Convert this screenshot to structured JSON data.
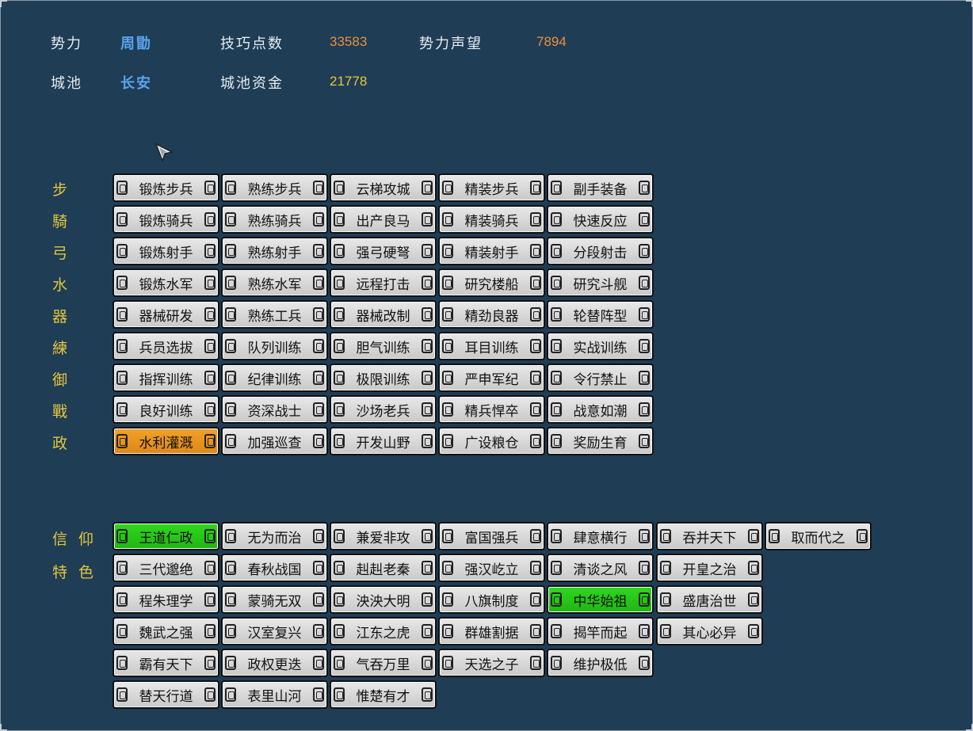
{
  "header": {
    "faction_label": "势力",
    "faction_value": "周勖",
    "skill_points_label": "技巧点数",
    "skill_points_value": "33583",
    "prestige_label": "势力声望",
    "prestige_value": "7894",
    "city_label": "城池",
    "city_value": "长安",
    "city_funds_label": "城池资金",
    "city_funds_value": "21778"
  },
  "colors": {
    "background": "#1f3d55",
    "accent_blue": "#5aa4ee",
    "accent_orange": "#e8913c",
    "accent_yellow": "#e8c93a",
    "selected_orange": "#f2a128",
    "selected_green": "#2fd81d"
  },
  "techniques": {
    "rows": [
      {
        "label": "步",
        "items": [
          "锻炼步兵",
          "熟练步兵",
          "云梯攻城",
          "精装步兵",
          "副手装备"
        ]
      },
      {
        "label": "騎",
        "items": [
          "锻炼骑兵",
          "熟练骑兵",
          "出产良马",
          "精装骑兵",
          "快速反应"
        ]
      },
      {
        "label": "弓",
        "items": [
          "锻炼射手",
          "熟练射手",
          "强弓硬弩",
          "精装射手",
          "分段射击"
        ]
      },
      {
        "label": "水",
        "items": [
          "锻炼水军",
          "熟练水军",
          "远程打击",
          "研究楼船",
          "研究斗舰"
        ]
      },
      {
        "label": "器",
        "items": [
          "器械研发",
          "熟练工兵",
          "器械改制",
          "精劲良器",
          "轮替阵型"
        ]
      },
      {
        "label": "練",
        "items": [
          "兵员选拔",
          "队列训练",
          "胆气训练",
          "耳目训练",
          "实战训练"
        ]
      },
      {
        "label": "御",
        "items": [
          "指挥训练",
          "纪律训练",
          "极限训练",
          "严申军纪",
          "令行禁止"
        ]
      },
      {
        "label": "戰",
        "items": [
          "良好训练",
          "资深战士",
          "沙场老兵",
          "精兵悍卒",
          "战意如潮"
        ]
      },
      {
        "label": "政",
        "items": [
          "水利灌溉",
          "加强巡查",
          "开发山野",
          "广设粮仓",
          "奖励生育"
        ]
      }
    ]
  },
  "beliefs": {
    "label_1": "信仰",
    "label_2": "特色",
    "rows": [
      [
        "王道仁政",
        "无为而治",
        "兼爱非攻",
        "富国强兵",
        "肆意横行",
        "吞并天下",
        "取而代之"
      ],
      [
        "三代邈绝",
        "春秋战国",
        "赳赳老秦",
        "强汉屹立",
        "清谈之风",
        "开皇之治"
      ],
      [
        "程朱理学",
        "蒙骑无双",
        "泱泱大明",
        "八旗制度",
        "中华始祖",
        "盛唐治世"
      ],
      [
        "魏武之强",
        "汉室复兴",
        "江东之虎",
        "群雄割据",
        "揭竿而起",
        "其心必异"
      ],
      [
        "霸有天下",
        "政权更迭",
        "气吞万里",
        "天选之子",
        "维护极低"
      ],
      [
        "替天行道",
        "表里山河",
        "惟楚有才"
      ]
    ]
  }
}
